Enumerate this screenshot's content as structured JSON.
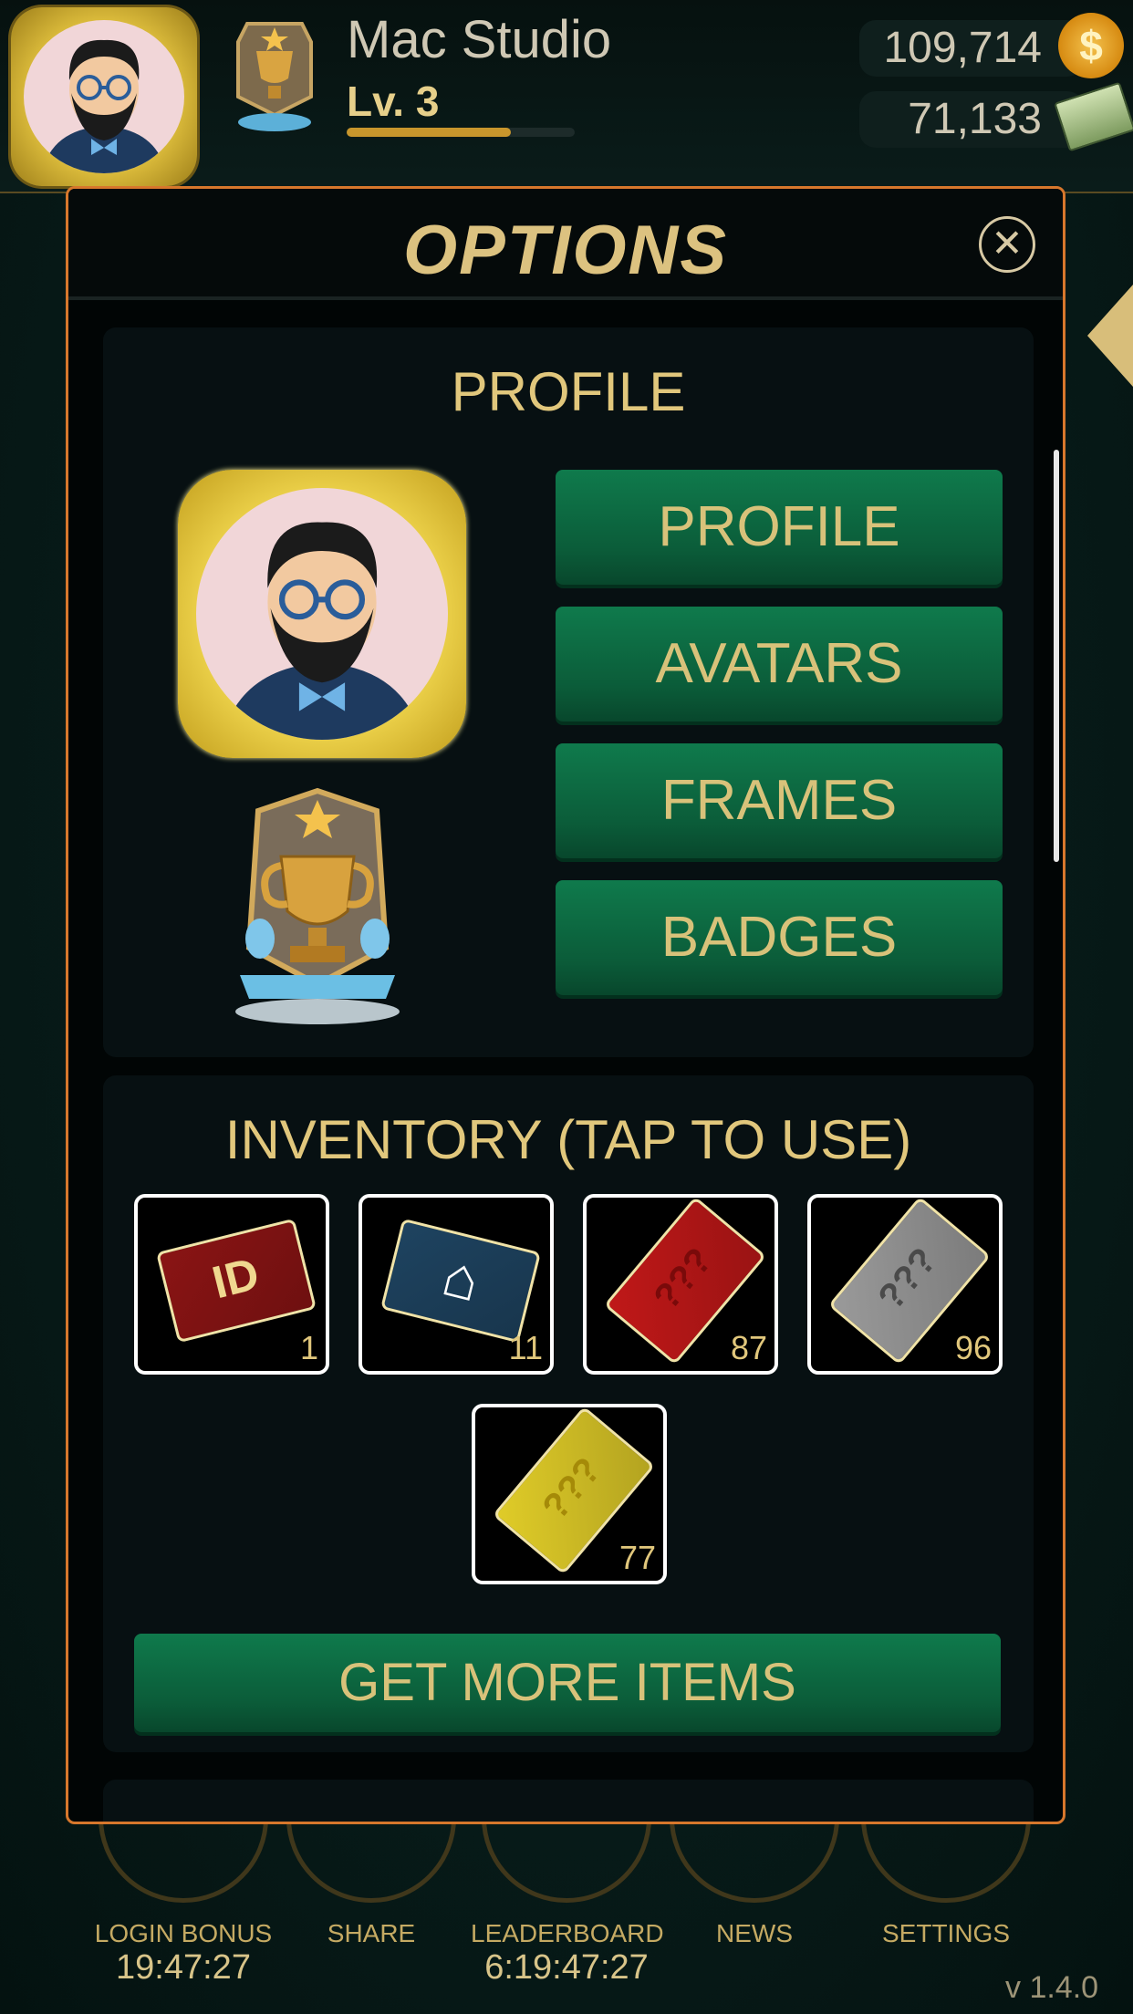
{
  "header": {
    "player_name": "Mac Studio",
    "level": "Lv. 3",
    "xp_progress": 0.72,
    "coins": "109,714",
    "coin_symbol": "$",
    "cash": "71,133"
  },
  "modal": {
    "title": "OPTIONS",
    "close_symbol": "✕",
    "profile_section": {
      "title": "PROFILE",
      "buttons": [
        "PROFILE",
        "AVATARS",
        "FRAMES",
        "BADGES"
      ]
    },
    "inventory_section": {
      "title": "INVENTORY (TAP TO USE)",
      "items": [
        {
          "icon": "id-card-icon",
          "ticket_text": "ID",
          "count": "1",
          "color": "#8a1414"
        },
        {
          "icon": "house-card-icon",
          "ticket_text": "⌂",
          "count": "11",
          "color": "#1e4360"
        },
        {
          "icon": "red-mystery-card-icon",
          "ticket_text": "???",
          "count": "87",
          "color": "#c01818"
        },
        {
          "icon": "silver-mystery-card-icon",
          "ticket_text": "???",
          "count": "96",
          "color": "#9a9a9a"
        },
        {
          "icon": "gold-mystery-card-icon",
          "ticket_text": "???",
          "count": "77",
          "color": "#e0cc28"
        }
      ],
      "get_more_label": "GET MORE ITEMS"
    }
  },
  "bottom_nav": [
    {
      "label": "LOGIN BONUS",
      "timer": "19:47:27"
    },
    {
      "label": "SHARE",
      "timer": ""
    },
    {
      "label": "LEADERBOARD",
      "timer": "6:19:47:27"
    },
    {
      "label": "NEWS",
      "timer": ""
    },
    {
      "label": "SETTINGS",
      "timer": ""
    }
  ],
  "version": "v 1.4.0"
}
